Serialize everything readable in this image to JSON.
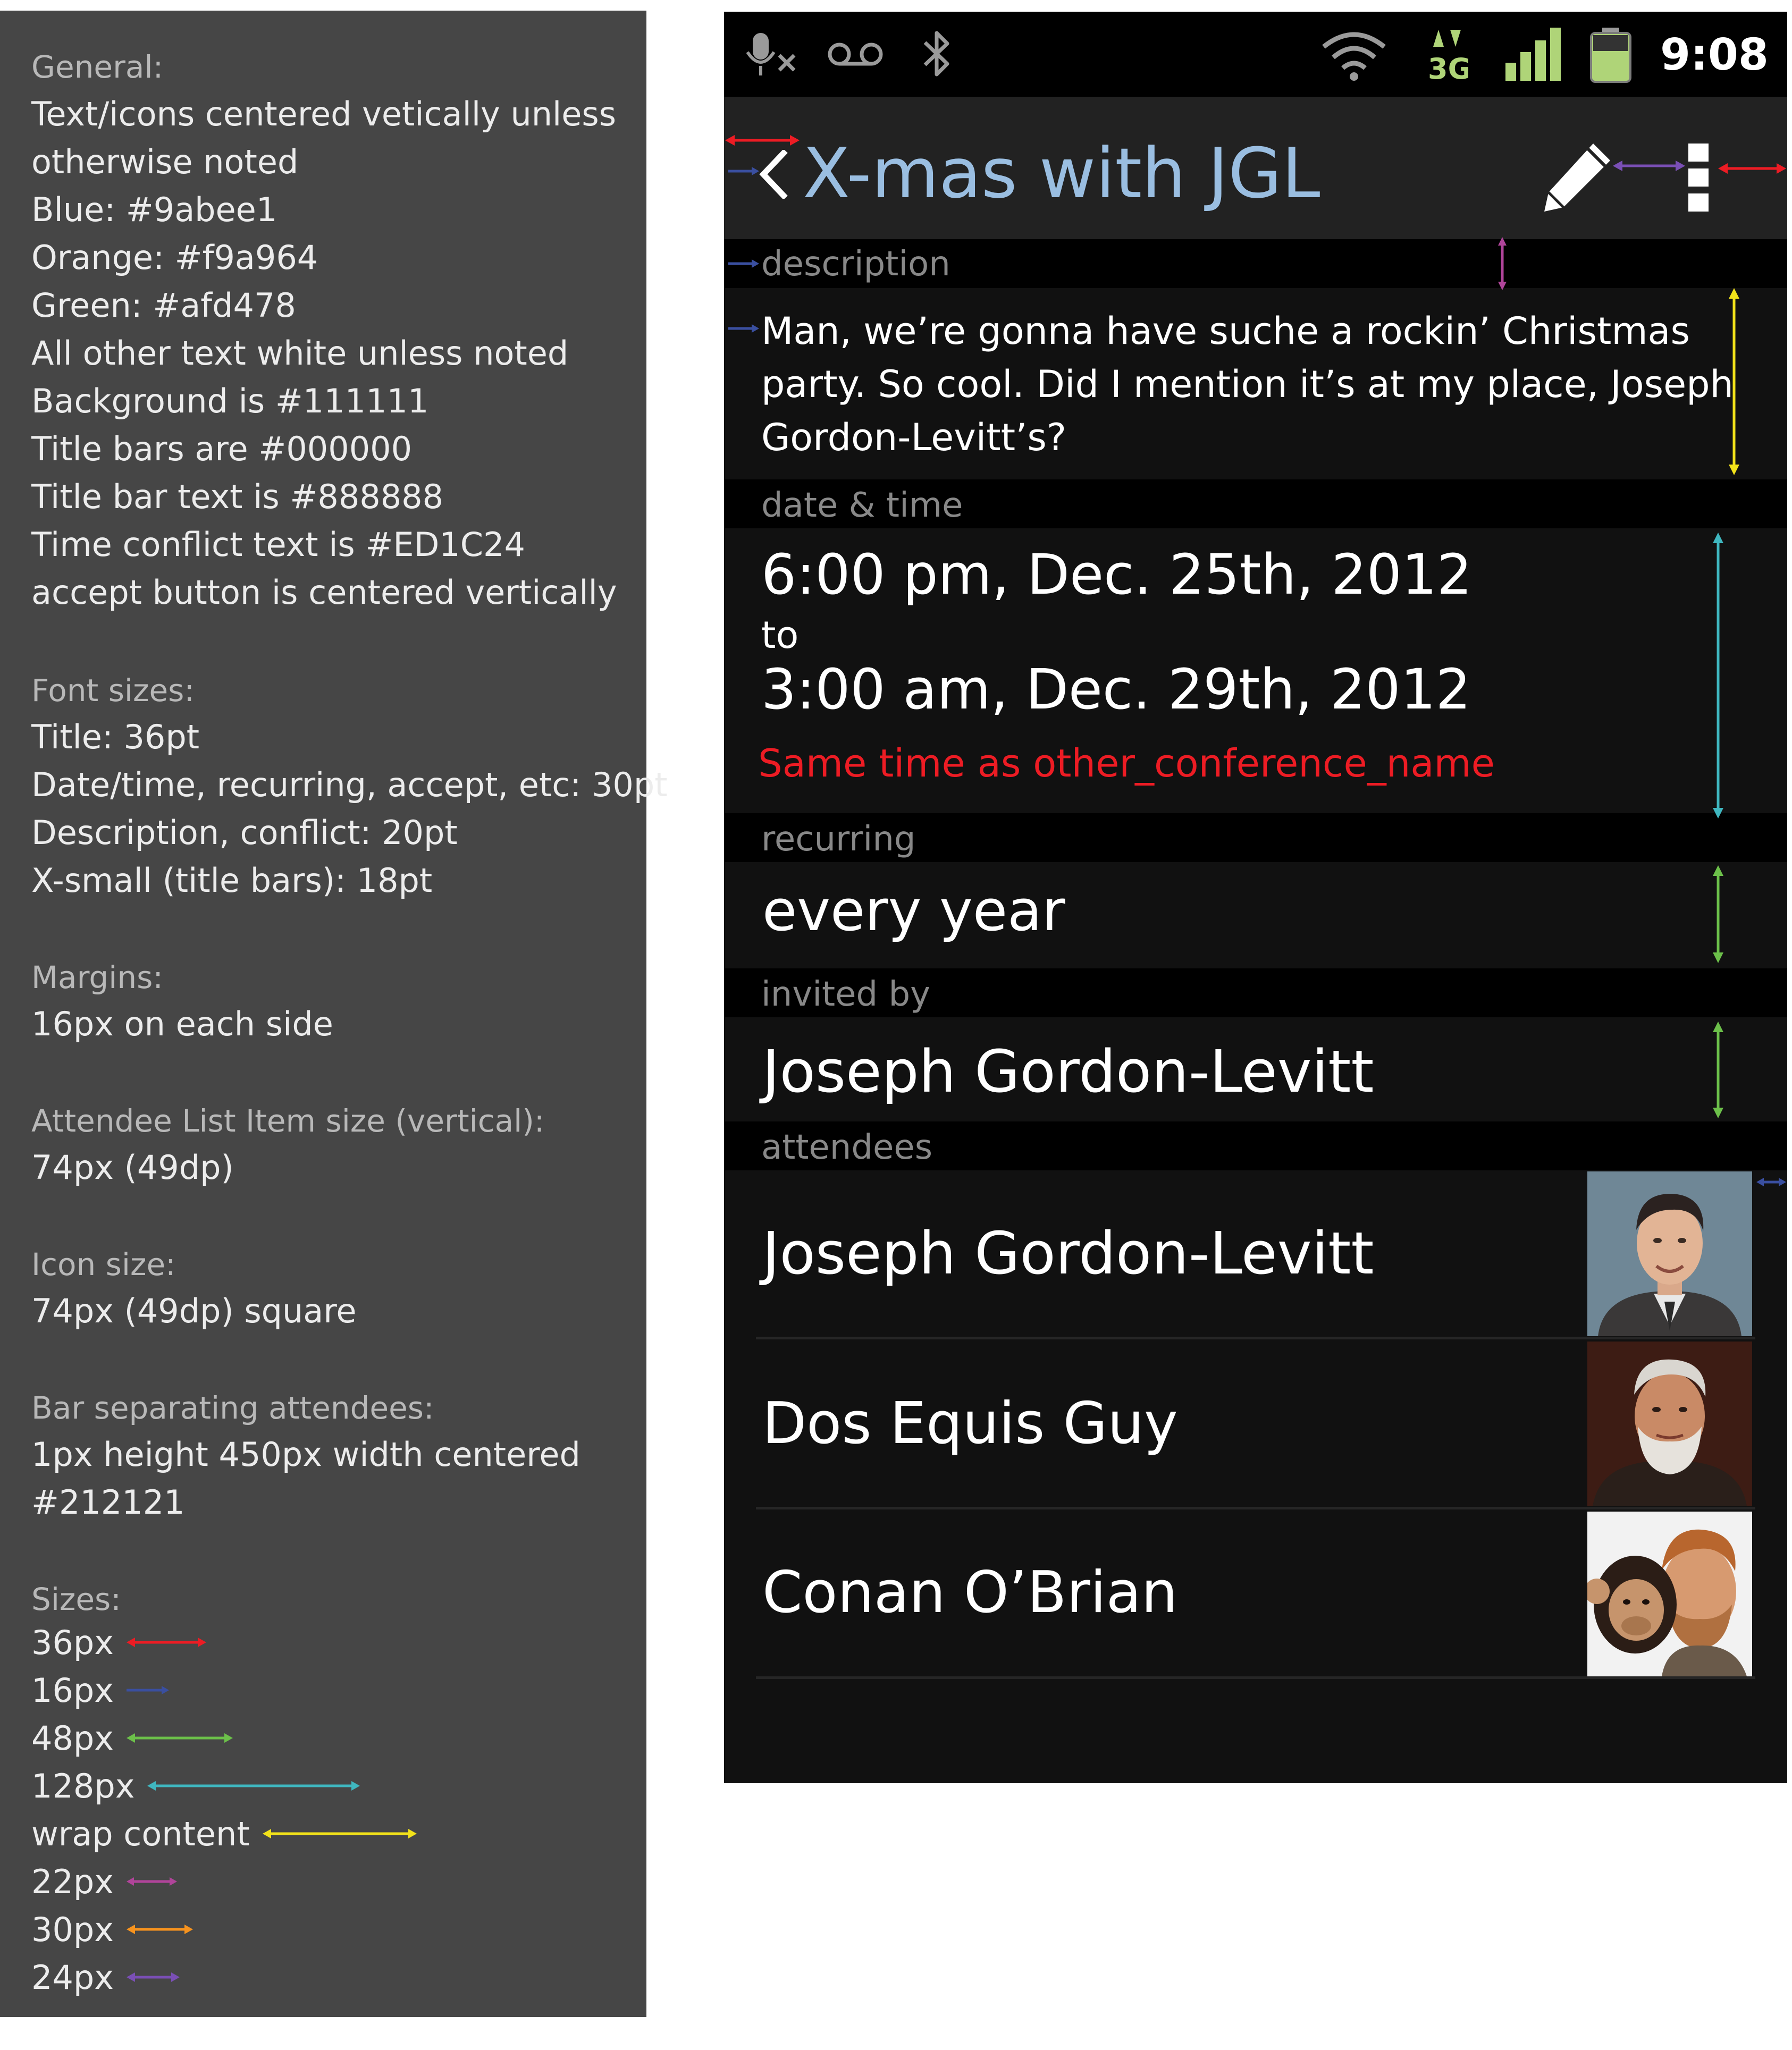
{
  "spec": {
    "general_heading": "General:",
    "general_lines": [
      "Text/icons centered vetically unless",
      "otherwise noted",
      "Blue: #9abee1",
      "Orange: #f9a964",
      "Green: #afd478",
      "All other text white unless noted",
      "Background is #111111",
      "Title bars are #000000",
      "Title bar text is #888888",
      "Time conflict text is #ED1C24",
      "accept button is centered vertically"
    ],
    "font_heading": "Font sizes:",
    "font_lines": [
      "Title: 36pt",
      "Date/time, recurring, accept, etc: 30pt",
      "Description, conflict: 20pt",
      "X-small (title bars): 18pt"
    ],
    "margins_heading": "Margins:",
    "margins_value": "16px on each side",
    "attendee_heading": "Attendee List Item size (vertical):",
    "attendee_value": "74px (49dp)",
    "icon_heading": "Icon size:",
    "icon_value": "74px (49dp) square",
    "bar_heading": "Bar separating attendees:",
    "bar_lines": [
      "1px height 450px width centered",
      "#212121"
    ],
    "sizes_heading": "Sizes:",
    "sizes_legend": [
      {
        "label": "36px",
        "color": "#ed1c24"
      },
      {
        "label": "16px",
        "color": "#3a4fa0"
      },
      {
        "label": "48px",
        "color": "#6cc04a"
      },
      {
        "label": "128px",
        "color": "#3fb7c0"
      },
      {
        "label": "wrap content",
        "color": "#f2e21a"
      },
      {
        "label": "22px",
        "color": "#b0449a"
      },
      {
        "label": "30px",
        "color": "#f7931e"
      },
      {
        "label": "24px",
        "color": "#7a4fb5"
      }
    ]
  },
  "colors": {
    "blue": "#9abee1",
    "orange": "#f9a964",
    "green": "#afd478",
    "background": "#111111",
    "title_bar": "#000000",
    "title_bar_text": "#888888",
    "conflict": "#ED1C24",
    "separator": "#212121"
  },
  "status_bar": {
    "time": "9:08",
    "icons": [
      "mic-muted-icon",
      "voicemail-icon",
      "bluetooth-icon",
      "wifi-icon",
      "3g-data-icon",
      "signal-icon",
      "battery-icon"
    ]
  },
  "action_bar": {
    "title": "X-mas with JGL",
    "icons": [
      "back-chevron-icon",
      "edit-pencil-icon",
      "overflow-menu-icon"
    ]
  },
  "event": {
    "description_label": "description",
    "description_lines": [
      "Man, we’re gonna have suche a rockin’ Christmas",
      "party. So cool. Did I mention it’s at my place, Joseph",
      "Gordon-Levitt’s?"
    ],
    "datetime_label": "date & time",
    "start": "6:00 pm, Dec. 25th, 2012",
    "to": "to",
    "end": "3:00 am, Dec. 29th, 2012",
    "conflict": "Same time as other_conference_name",
    "recurring_label": "recurring",
    "recurring": "every year",
    "invited_label": "invited by",
    "invited_by": "Joseph Gordon-Levitt",
    "attendees_label": "attendees",
    "attendees": [
      {
        "name": "Joseph Gordon-Levitt"
      },
      {
        "name": "Dos Equis Guy"
      },
      {
        "name": "Conan O’Brian"
      }
    ]
  }
}
